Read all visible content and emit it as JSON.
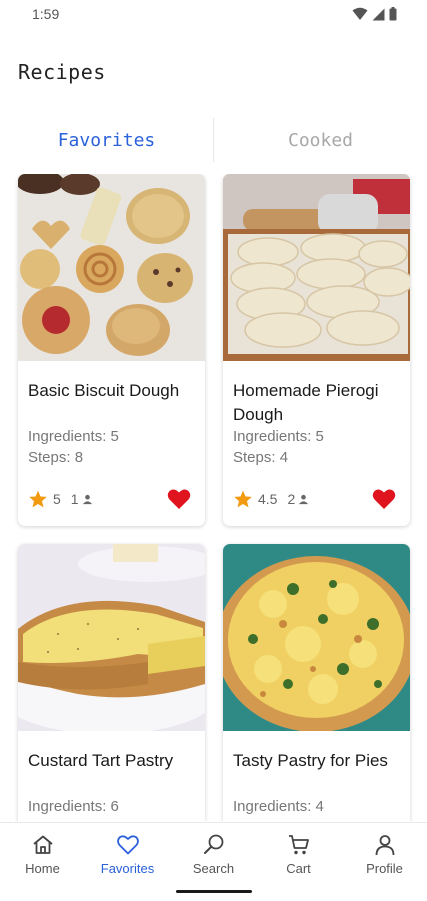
{
  "status": {
    "time": "1:59"
  },
  "header": {
    "title": "Recipes"
  },
  "tabs": [
    {
      "label": "Favorites",
      "active": true
    },
    {
      "label": "Cooked",
      "active": false
    }
  ],
  "recipes": [
    {
      "title": "Basic Biscuit Dough",
      "ingredients": "Ingredients: 5",
      "steps": "Steps: 8",
      "rating": "5",
      "cooks": "1",
      "favorite": true
    },
    {
      "title": "Homemade Pierogi Dough",
      "ingredients": "Ingredients: 5",
      "steps": "Steps: 4",
      "rating": "4.5",
      "cooks": "2",
      "favorite": true
    },
    {
      "title": "Custard Tart Pastry",
      "ingredients": "Ingredients: 6",
      "steps": "",
      "rating": "",
      "cooks": "",
      "favorite": true
    },
    {
      "title": "Tasty Pastry for Pies",
      "ingredients": "Ingredients: 4",
      "steps": "",
      "rating": "",
      "cooks": "",
      "favorite": true
    }
  ],
  "bottom_nav": {
    "items": [
      {
        "label": "Home",
        "icon": "home-icon",
        "active": false
      },
      {
        "label": "Favorites",
        "icon": "heart-outline-icon",
        "active": true
      },
      {
        "label": "Search",
        "icon": "search-icon",
        "active": false
      },
      {
        "label": "Cart",
        "icon": "cart-icon",
        "active": false
      },
      {
        "label": "Profile",
        "icon": "person-icon",
        "active": false
      }
    ]
  },
  "colors": {
    "accent": "#2b62d9",
    "heart": "#e0141e",
    "star": "#f29a12",
    "inactive_tab": "#a0a0a0"
  }
}
